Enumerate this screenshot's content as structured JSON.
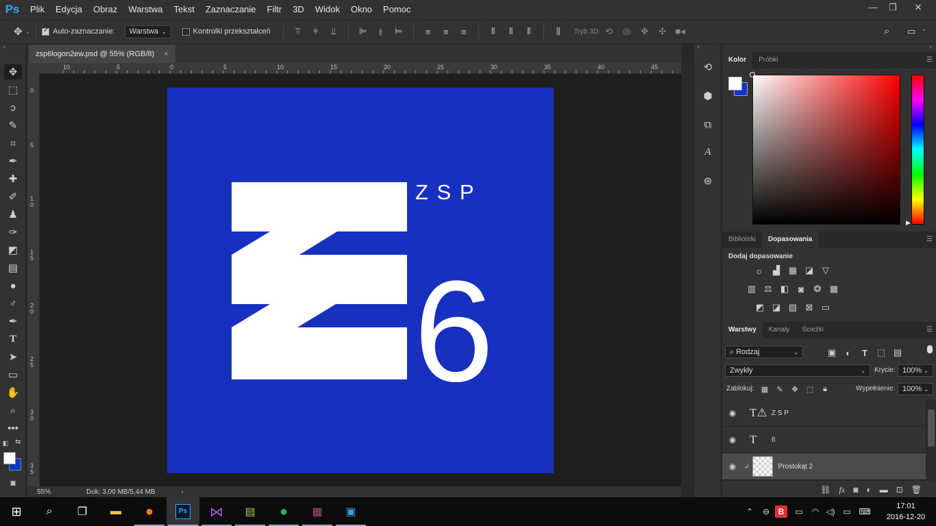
{
  "app": {
    "logo": "Ps",
    "menu": [
      "Plik",
      "Edycja",
      "Obraz",
      "Warstwa",
      "Tekst",
      "Zaznaczanie",
      "Filtr",
      "3D",
      "Widok",
      "Okno",
      "Pomoc"
    ]
  },
  "options_bar": {
    "auto_select_label": "Auto-zaznaczanie:",
    "auto_select_checked": true,
    "auto_select_value": "Warstwa",
    "transform_controls_label": "Kontrolki przekształceń",
    "mode_3d_label": "Tryb 3D:"
  },
  "document": {
    "tab_title": "zsp6logon2ew.psd @ 55% (RGB/8)",
    "close_glyph": "×",
    "ruler_top_labels": [
      "10",
      "5",
      "0",
      "5",
      "10",
      "15",
      "20",
      "25",
      "30",
      "35",
      "40",
      "45"
    ],
    "ruler_left_labels": [
      "0",
      "5",
      "1\n0",
      "1\n5",
      "2\n0",
      "2\n5",
      "3\n0",
      "3\n5"
    ],
    "zoom": "55%",
    "doc_size": "Dok: 3,00 MB/5,44 MB",
    "artwork": {
      "background_color": "#1830c0",
      "zsp_text": "Z S P",
      "number_text": "6"
    }
  },
  "color_panel": {
    "tabs": [
      "Kolor",
      "Próbki"
    ],
    "active_tab": "Kolor",
    "foreground": "#ffffff",
    "background": "#0d35c8"
  },
  "adjustments_panel": {
    "tabs": [
      "Biblioteki",
      "Dopasowania"
    ],
    "active_tab": "Dopasowania",
    "heading": "Dodaj dopasowanie"
  },
  "layers_panel": {
    "tabs": [
      "Warstwy",
      "Kanały",
      "Ścieżki"
    ],
    "active_tab": "Warstwy",
    "filter_label": "Rodzaj",
    "blend_mode": "Zwykły",
    "opacity_label": "Krycie:",
    "opacity_value": "100%",
    "lock_label": "Zablokuj:",
    "fill_label": "Wypełnienie:",
    "fill_value": "100%",
    "layers": [
      {
        "name": "Z S P",
        "type": "text-warning"
      },
      {
        "name": "6",
        "type": "text"
      },
      {
        "name": "Prostokąt 2",
        "type": "shape"
      }
    ]
  },
  "taskbar": {
    "time": "17:01",
    "date": "2016-12-20",
    "apps": [
      "start",
      "search",
      "task-view",
      "file-explorer",
      "firefox",
      "photoshop",
      "visual-studio",
      "notepad-plus-plus",
      "spotify",
      "winrar",
      "video-editor"
    ]
  }
}
